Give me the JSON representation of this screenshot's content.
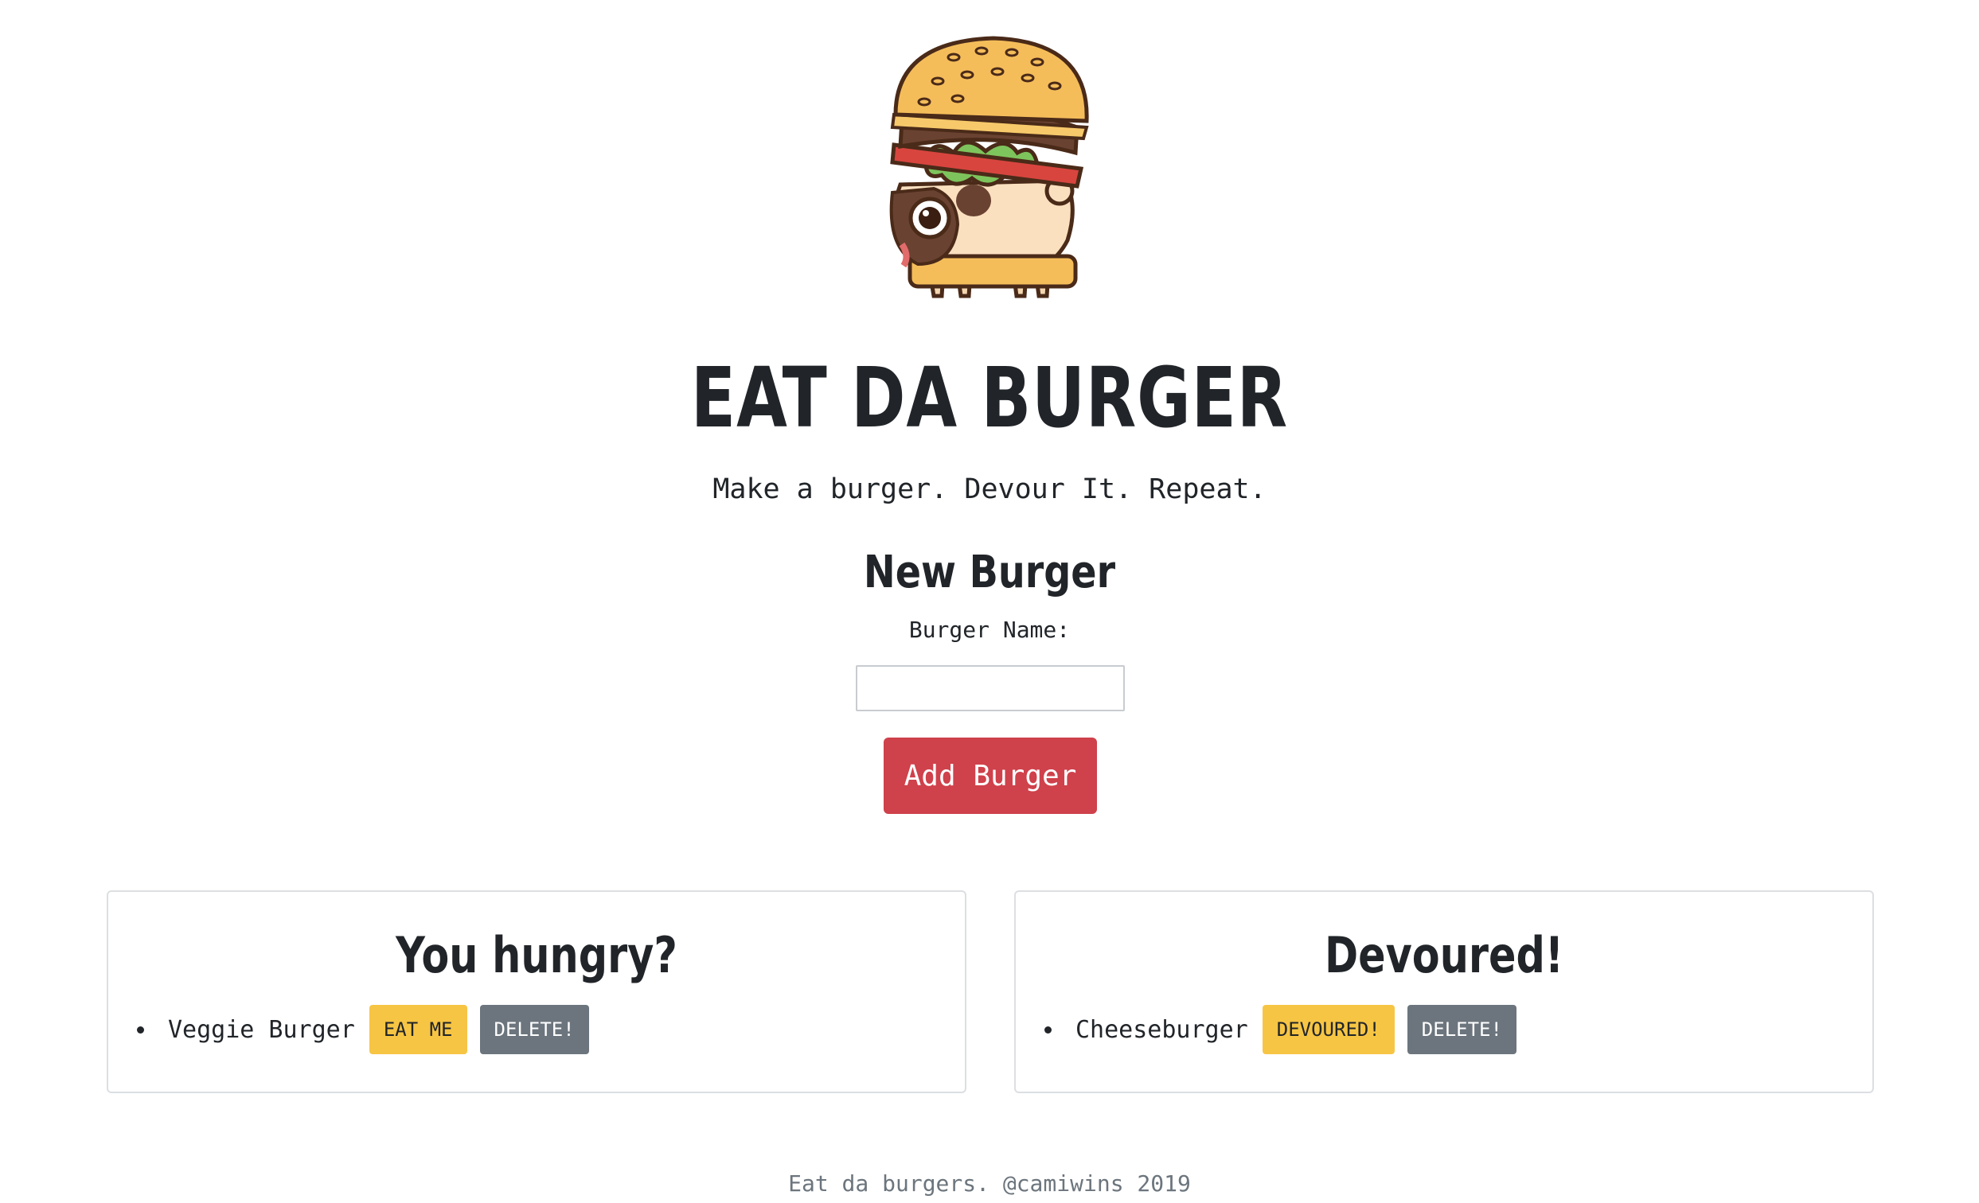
{
  "header": {
    "logo_icon": "burger-pug-icon",
    "title": "EAT DA BURGER",
    "subtitle": "Make a burger. Devour It. Repeat."
  },
  "form": {
    "heading": "New Burger",
    "label": "Burger Name:",
    "input_value": "",
    "input_placeholder": "",
    "submit_label": "Add Burger"
  },
  "hungry": {
    "title": "You hungry?",
    "items": [
      {
        "name": "Veggie Burger",
        "action_label": "EAT ME",
        "delete_label": "DELETE!"
      }
    ]
  },
  "devoured": {
    "title": "Devoured!",
    "items": [
      {
        "name": "Cheeseburger",
        "action_label": "DEVOURED!",
        "delete_label": "DELETE!"
      }
    ]
  },
  "footer": {
    "text": "Eat da burgers. @camiwins 2019"
  },
  "colors": {
    "primary_button": "#cf414b",
    "warning_button": "#f7c544",
    "secondary_button": "#6c757d"
  }
}
